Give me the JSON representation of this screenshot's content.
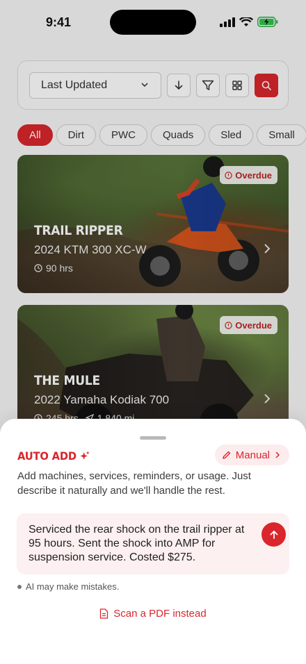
{
  "status_bar": {
    "time": "9:41"
  },
  "filter": {
    "sort_label": "Last Updated"
  },
  "chips": [
    "All",
    "Dirt",
    "PWC",
    "Quads",
    "Sled",
    "Small"
  ],
  "machines": [
    {
      "name": "TRAIL RIPPER",
      "model": "2024 KTM 300 XC-W",
      "hours": "90 hrs",
      "miles": "",
      "badge": "Overdue"
    },
    {
      "name": "THE MULE",
      "model": "2022 Yamaha Kodiak 700",
      "hours": "245 hrs",
      "miles": "1,840 mi",
      "badge": "Overdue"
    }
  ],
  "sheet": {
    "title": "AUTO ADD",
    "manual_label": "Manual",
    "description": "Add machines, services, reminders, or usage. Just describe it naturally and we'll handle the rest.",
    "input_text": "Serviced the rear shock on the trail ripper at 95 hours.  Sent the shock into AMP for suspension service.  Costed $275.",
    "disclaimer": "AI may make mistakes.",
    "scan_label": "Scan a PDF instead"
  },
  "colors": {
    "accent": "#d9262c",
    "accent_soft": "#fdf0f0"
  },
  "icons": [
    "sort-down-icon",
    "filter-icon",
    "grid-icon",
    "search-icon",
    "sparkle-icon",
    "pencil-icon",
    "send-arrow-icon",
    "document-icon",
    "clock-icon",
    "chevron-right-icon"
  ]
}
